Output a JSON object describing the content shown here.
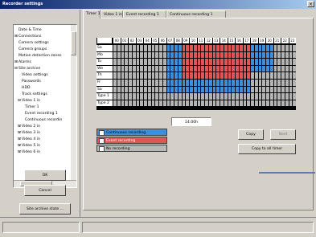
{
  "window": {
    "title": "Recorder settings"
  },
  "tree": {
    "items": [
      {
        "label": "Date & Time",
        "indent": 0,
        "exp": ""
      },
      {
        "label": "Connections",
        "indent": 0,
        "exp": "+"
      },
      {
        "label": "Camera settings",
        "indent": 0,
        "exp": ""
      },
      {
        "label": "Camera groups",
        "indent": 0,
        "exp": ""
      },
      {
        "label": "Motion detection zones",
        "indent": 0,
        "exp": ""
      },
      {
        "label": "Alarms",
        "indent": 0,
        "exp": "+"
      },
      {
        "label": "Site archive",
        "indent": 0,
        "exp": "-"
      },
      {
        "label": "Video settings",
        "indent": 1,
        "exp": ""
      },
      {
        "label": "Passwords",
        "indent": 1,
        "exp": ""
      },
      {
        "label": "HDD",
        "indent": 1,
        "exp": ""
      },
      {
        "label": "Track settings",
        "indent": 1,
        "exp": ""
      },
      {
        "label": "Video 1 in",
        "indent": 1,
        "exp": "-"
      },
      {
        "label": "Timer 1",
        "indent": 2,
        "exp": ""
      },
      {
        "label": "Event recording 1",
        "indent": 2,
        "exp": ""
      },
      {
        "label": "Continuous recordin",
        "indent": 2,
        "exp": ""
      },
      {
        "label": "Video 2 in",
        "indent": 1,
        "exp": "+"
      },
      {
        "label": "Video 3 in",
        "indent": 1,
        "exp": "+"
      },
      {
        "label": "Video 4 in",
        "indent": 1,
        "exp": "+"
      },
      {
        "label": "Video 5 in",
        "indent": 1,
        "exp": "+"
      },
      {
        "label": "Video 6 in",
        "indent": 1,
        "exp": "+"
      }
    ]
  },
  "buttons": {
    "ok": "OK",
    "cancel": "Cancel",
    "save": "Site archive state ...",
    "copy": "Copy",
    "next": "Next",
    "copy_all": "Copy to all timer"
  },
  "tabs": [
    "Timer 1",
    "Video 1 in",
    "Event recording 1",
    "Continuous recording 1"
  ],
  "schedule": {
    "hours": [
      "00",
      "01",
      "02",
      "03",
      "04",
      "05",
      "06",
      "07",
      "08",
      "09",
      "10",
      "11",
      "12",
      "13",
      "14",
      "15",
      "16",
      "17",
      "18",
      "19",
      "20",
      "21",
      "22",
      "23"
    ],
    "days": [
      "Sa",
      "Mo",
      "Tu",
      "We",
      "Th",
      "Fr",
      "Sa",
      "Type 1",
      "Type 2"
    ],
    "time_display": "14:00h",
    "colors": {
      "continuous": "#3d8fd9",
      "event": "#e05555",
      "none": "#b8b8b8",
      "grid_empty": "#b4b4b4"
    }
  },
  "legend": [
    {
      "label": "Continuous recording",
      "checked": false
    },
    {
      "label": "Event recording",
      "checked": true
    },
    {
      "label": "No recording",
      "checked": false
    }
  ]
}
